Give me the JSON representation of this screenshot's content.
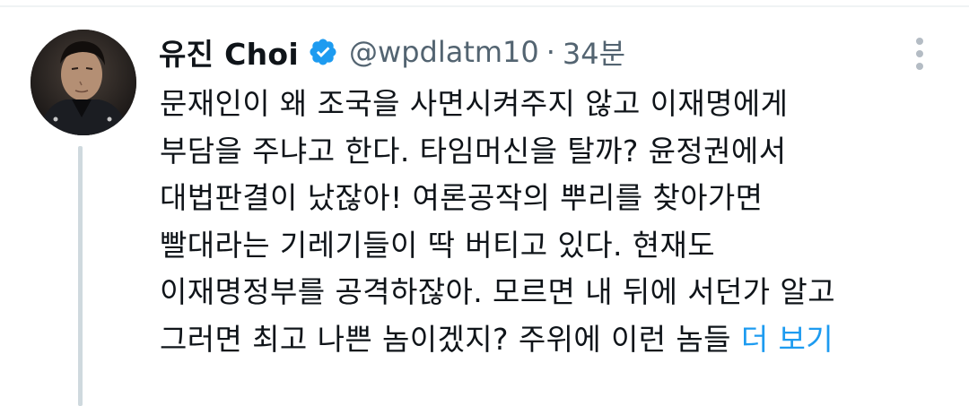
{
  "tweet": {
    "author": {
      "display_name": "유진 Choi",
      "handle": "@wpdlatm10",
      "verified": true,
      "avatar_icon": "profile-photo"
    },
    "separator": "·",
    "time": "34분",
    "body_lines": [
      "문재인이 왜 조국을 사면시켜주지 않고 이재명에게",
      "부담을 주냐고 한다. 타임머신을 탈까? 윤정권에서",
      "대법판결이 났잖아! 여론공작의 뿌리를 찾아가면",
      "빨대라는 기레기들이 딱 버티고 있다. 현재도",
      "이재명정부를 공격하잖아. 모르면 내 뒤에 서던가 알고",
      "그러면 최고 나쁜 놈이겠지? 주위에 이런 놈들"
    ],
    "show_more_label": "더 보기"
  },
  "icons": {
    "verified": "verified-badge-icon",
    "more": "more-vertical-icon"
  },
  "colors": {
    "text_primary": "#0f1419",
    "text_secondary": "#536471",
    "link": "#1d9bf0",
    "verified": "#1d9bf0",
    "thread_line": "#cfd9de"
  }
}
